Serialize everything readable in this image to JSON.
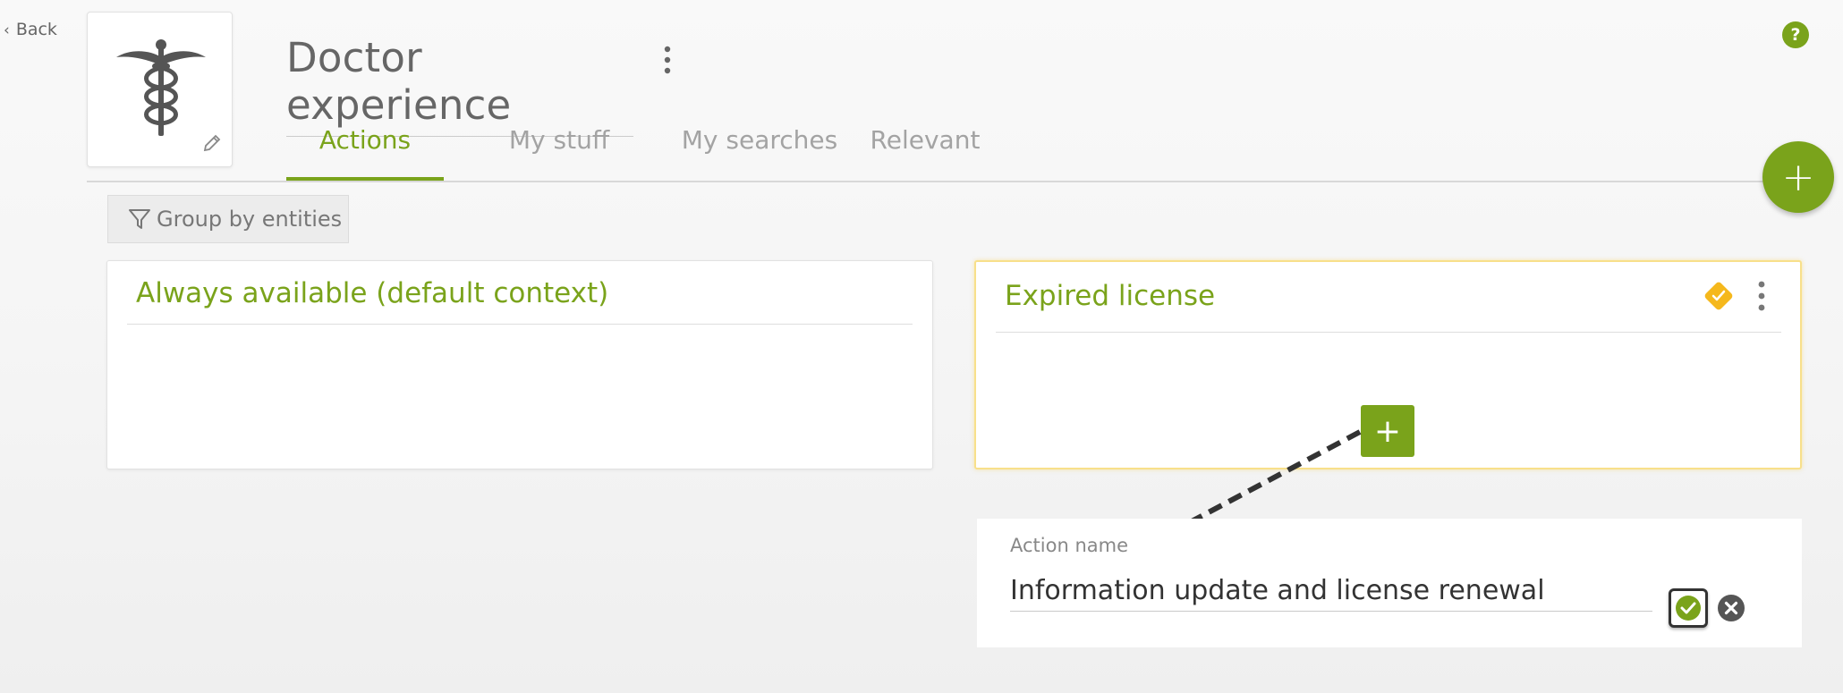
{
  "nav": {
    "back_label": "Back"
  },
  "header": {
    "title": "Doctor experience",
    "help_label": "?"
  },
  "tabs": [
    {
      "label": "Actions",
      "active": true
    },
    {
      "label": "My stuff",
      "active": false
    },
    {
      "label": "My searches",
      "active": false
    },
    {
      "label": "Relevant",
      "active": false
    }
  ],
  "fab_label": "+",
  "group_by": {
    "label": "Group by entities"
  },
  "contexts": [
    {
      "title": "Always available (default context)"
    },
    {
      "title": "Expired license",
      "add_label": "+"
    }
  ],
  "action_form": {
    "label": "Action name",
    "value": "Information update and license renewal"
  },
  "colors": {
    "accent": "#7aa31b",
    "warning": "#f5b81c",
    "highlight_border": "#f8e08a"
  },
  "icons": [
    "chevron-left-icon",
    "caduceus-icon",
    "pencil-icon",
    "kebab-menu-icon",
    "help-icon",
    "plus-icon",
    "filter-icon",
    "diamond-check-icon",
    "check-circle-icon",
    "close-circle-icon"
  ]
}
